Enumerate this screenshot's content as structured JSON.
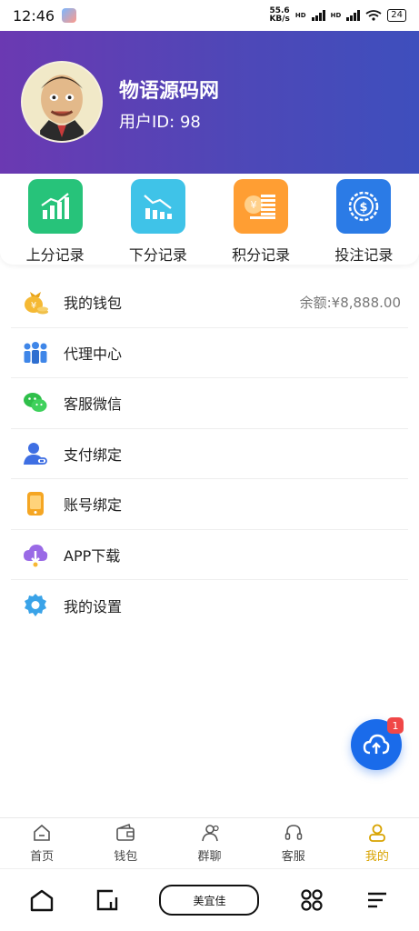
{
  "status": {
    "time": "12:46",
    "speed_value": "55.6",
    "speed_unit": "KB/s",
    "hd1": "HD",
    "hd2": "HD",
    "battery": "24"
  },
  "header": {
    "username": "物语源码网",
    "user_id": "用户ID: 98",
    "gradient_start": "#6b39b2",
    "gradient_end": "#3e4fbd"
  },
  "quick_actions": [
    {
      "label": "上分记录",
      "color": "#27c37a",
      "icon": "bar-chart-up-icon"
    },
    {
      "label": "下分记录",
      "color": "#3fc3e8",
      "icon": "bar-chart-down-icon"
    },
    {
      "label": "积分记录",
      "color": "#ff9e33",
      "icon": "coins-stack-icon"
    },
    {
      "label": "投注记录",
      "color": "#2b7be6",
      "icon": "dollar-coin-icon"
    }
  ],
  "menu": [
    {
      "label": "我的钱包",
      "value": "余额:¥8,888.00",
      "icon": "money-bag-icon"
    },
    {
      "label": "代理中心",
      "icon": "team-icon"
    },
    {
      "label": "客服微信",
      "icon": "wechat-icon"
    },
    {
      "label": "支付绑定",
      "icon": "user-link-icon"
    },
    {
      "label": "账号绑定",
      "icon": "phone-icon"
    },
    {
      "label": "APP下载",
      "icon": "cloud-download-icon"
    },
    {
      "label": "我的设置",
      "icon": "gear-icon"
    }
  ],
  "fab": {
    "badge": "1",
    "icon": "cloud-upload-icon"
  },
  "tabs": [
    {
      "label": "首页",
      "icon": "home-icon"
    },
    {
      "label": "钱包",
      "icon": "wallet-icon"
    },
    {
      "label": "群聊",
      "icon": "group-icon"
    },
    {
      "label": "客服",
      "icon": "headset-icon"
    },
    {
      "label": "我的",
      "icon": "profile-icon",
      "active": true
    }
  ],
  "tab_active_color": "#d8a300",
  "sysnav": {
    "pill_label": "美宜佳"
  }
}
